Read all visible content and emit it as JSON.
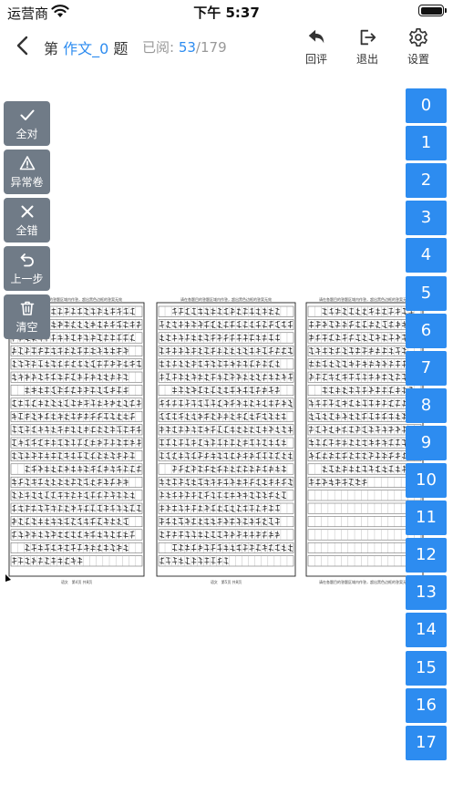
{
  "status_bar": {
    "carrier": "运营商",
    "time": "下午 5:37"
  },
  "header": {
    "title_prefix": "第 ",
    "question_name": "作文_0",
    "title_suffix": " 题",
    "read_label": "已阅: ",
    "read_count": "53",
    "read_separator": "/",
    "read_total": "179",
    "actions": [
      {
        "label": "回评",
        "icon": "undo-arrow-icon"
      },
      {
        "label": "退出",
        "icon": "exit-icon"
      },
      {
        "label": "设置",
        "icon": "gear-icon"
      }
    ]
  },
  "tools": [
    {
      "label": "全对",
      "icon": "check-icon"
    },
    {
      "label": "异常卷",
      "icon": "warning-icon"
    },
    {
      "label": "全错",
      "icon": "close-icon"
    },
    {
      "label": "上一步",
      "icon": "undo-icon"
    },
    {
      "label": "清空",
      "icon": "trash-icon"
    }
  ],
  "scores": [
    "0",
    "1",
    "2",
    "3",
    "4",
    "5",
    "6",
    "7",
    "8",
    "9",
    "10",
    "11",
    "12",
    "13",
    "14",
    "15",
    "16",
    "17"
  ],
  "sheet": {
    "headers": [
      "请在各题目的答题区域内作答，超出黑色边框的答案无效",
      "请在各题目的答题区域内作答，超出黑色边框的答案无效",
      "请在各题目的答题区域内作答，超出黑色边框的答案无效"
    ],
    "footers": [
      "语文　第4页 共8页",
      "语文　第5页 共8页",
      "请在各题目的答题区域内作答，超出黑色边框的答案无效"
    ]
  },
  "colors": {
    "accent": "#2d8cf0",
    "tool_bg": "#707b87"
  }
}
